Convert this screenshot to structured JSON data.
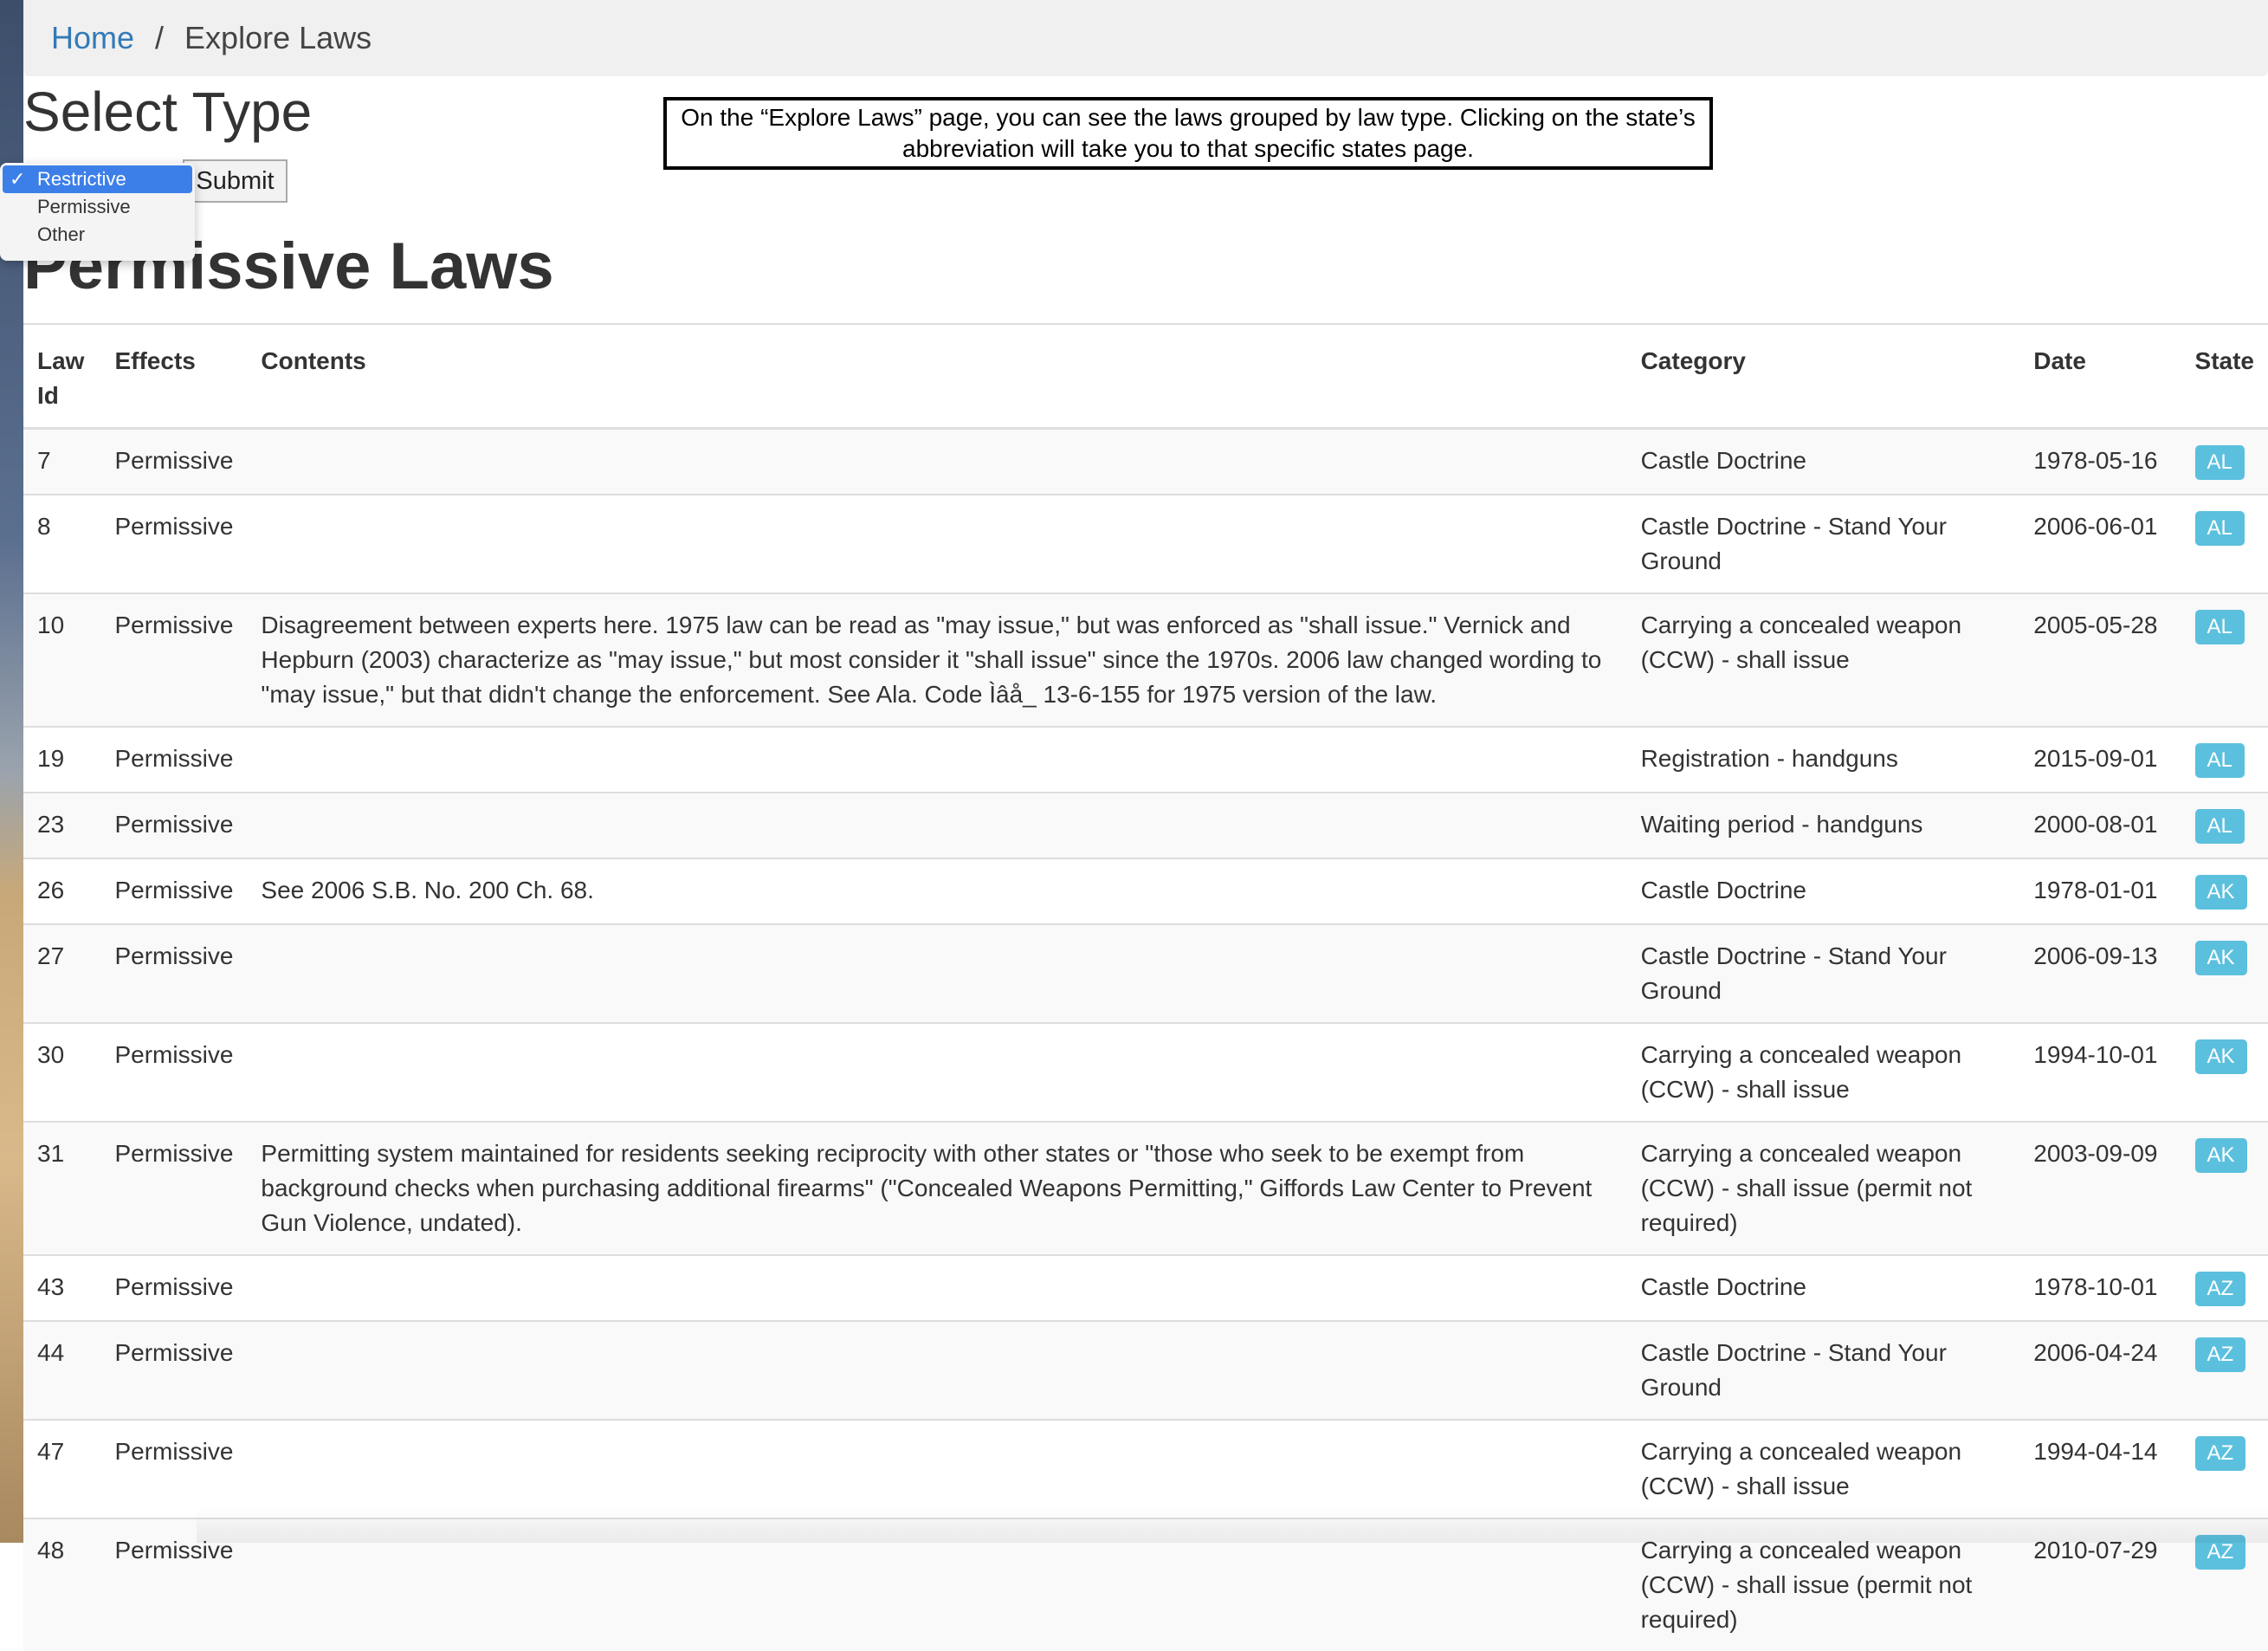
{
  "breadcrumb": {
    "home": "Home",
    "separator": "/",
    "current": "Explore Laws"
  },
  "select_section": {
    "title": "Select Type",
    "submit_label": "Submit"
  },
  "dropdown": {
    "options": [
      "Restrictive",
      "Permissive",
      "Other"
    ],
    "selected": "Restrictive",
    "check_glyph": "✓"
  },
  "annotation": {
    "line1": "On the “Explore Laws” page, you can see the laws grouped by law type. Clicking on the state’s",
    "line2": "abbreviation will take you to that specific states page."
  },
  "section_title": "Permissive Laws",
  "table": {
    "headers": {
      "id_line1": "Law",
      "id_line2": "Id",
      "effects": "Effects",
      "contents": "Contents",
      "category": "Category",
      "date": "Date",
      "state": "State"
    },
    "rows": [
      {
        "id": "7",
        "effects": "Permissive",
        "contents": "",
        "category": "Castle Doctrine",
        "date": "1978-05-16",
        "state": "AL"
      },
      {
        "id": "8",
        "effects": "Permissive",
        "contents": "",
        "category": "Castle Doctrine - Stand Your Ground",
        "date": "2006-06-01",
        "state": "AL"
      },
      {
        "id": "10",
        "effects": "Permissive",
        "contents": "Disagreement between experts here. 1975 law can be read as \"may issue,\" but was enforced as \"shall issue.\" Vernick and Hepburn (2003) characterize as \"may issue,\" but most consider it \"shall issue\" since the 1970s. 2006 law changed wording to \"may issue,\" but that didn't change the enforcement. See Ala. Code Ìâå_ 13-6-155 for 1975 version of the law.",
        "category": "Carrying a concealed weapon (CCW) - shall issue",
        "date": "2005-05-28",
        "state": "AL"
      },
      {
        "id": "19",
        "effects": "Permissive",
        "contents": "",
        "category": "Registration - handguns",
        "date": "2015-09-01",
        "state": "AL"
      },
      {
        "id": "23",
        "effects": "Permissive",
        "contents": "",
        "category": "Waiting period - handguns",
        "date": "2000-08-01",
        "state": "AL"
      },
      {
        "id": "26",
        "effects": "Permissive",
        "contents": "See 2006 S.B. No. 200 Ch. 68.",
        "category": "Castle Doctrine",
        "date": "1978-01-01",
        "state": "AK"
      },
      {
        "id": "27",
        "effects": "Permissive",
        "contents": "",
        "category": "Castle Doctrine - Stand Your Ground",
        "date": "2006-09-13",
        "state": "AK"
      },
      {
        "id": "30",
        "effects": "Permissive",
        "contents": "",
        "category": "Carrying a concealed weapon (CCW) - shall issue",
        "date": "1994-10-01",
        "state": "AK"
      },
      {
        "id": "31",
        "effects": "Permissive",
        "contents": "Permitting system maintained for residents seeking reciprocity with other states or \"those who seek to be exempt from background checks when purchasing additional firearms\" (\"Concealed Weapons Permitting,\" Giffords Law Center to Prevent Gun Violence, undated).",
        "category": "Carrying a concealed weapon (CCW) - shall issue (permit not required)",
        "date": "2003-09-09",
        "state": "AK"
      },
      {
        "id": "43",
        "effects": "Permissive",
        "contents": "",
        "category": "Castle Doctrine",
        "date": "1978-10-01",
        "state": "AZ"
      },
      {
        "id": "44",
        "effects": "Permissive",
        "contents": "",
        "category": "Castle Doctrine - Stand Your Ground",
        "date": "2006-04-24",
        "state": "AZ"
      },
      {
        "id": "47",
        "effects": "Permissive",
        "contents": "",
        "category": "Carrying a concealed weapon (CCW) - shall issue",
        "date": "1994-04-14",
        "state": "AZ"
      },
      {
        "id": "48",
        "effects": "Permissive",
        "contents": "",
        "category": "Carrying a concealed weapon (CCW) - shall issue (permit not required)",
        "date": "2010-07-29",
        "state": "AZ"
      }
    ]
  },
  "colors": {
    "link": "#337ab7",
    "badge": "#5bc0de",
    "dropdown_selected": "#3d7fe8",
    "breadcrumb_bg": "#f0f0f0"
  }
}
